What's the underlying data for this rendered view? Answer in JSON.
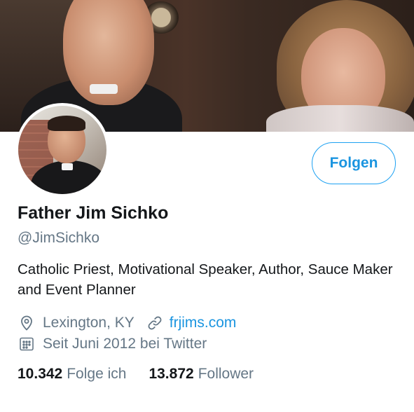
{
  "profile": {
    "display_name": "Father Jim Sichko",
    "handle": "@JimSichko",
    "bio": "Catholic Priest, Motivational Speaker, Author, Sauce Maker and Event Planner",
    "location": "Lexington, KY",
    "url": "frjims.com",
    "joined": "Seit Juni 2012 bei Twitter"
  },
  "actions": {
    "follow_label": "Folgen"
  },
  "stats": {
    "following_count": "10.342",
    "following_label": "Folge ich",
    "followers_count": "13.872",
    "followers_label": "Follower"
  },
  "icons": {
    "location": "map-pin-icon",
    "url": "link-icon",
    "joined": "calendar-icon"
  },
  "colors": {
    "accent": "#1da1f2",
    "link": "#1b95e0",
    "secondary_text": "#657786",
    "primary_text": "#14171a"
  }
}
